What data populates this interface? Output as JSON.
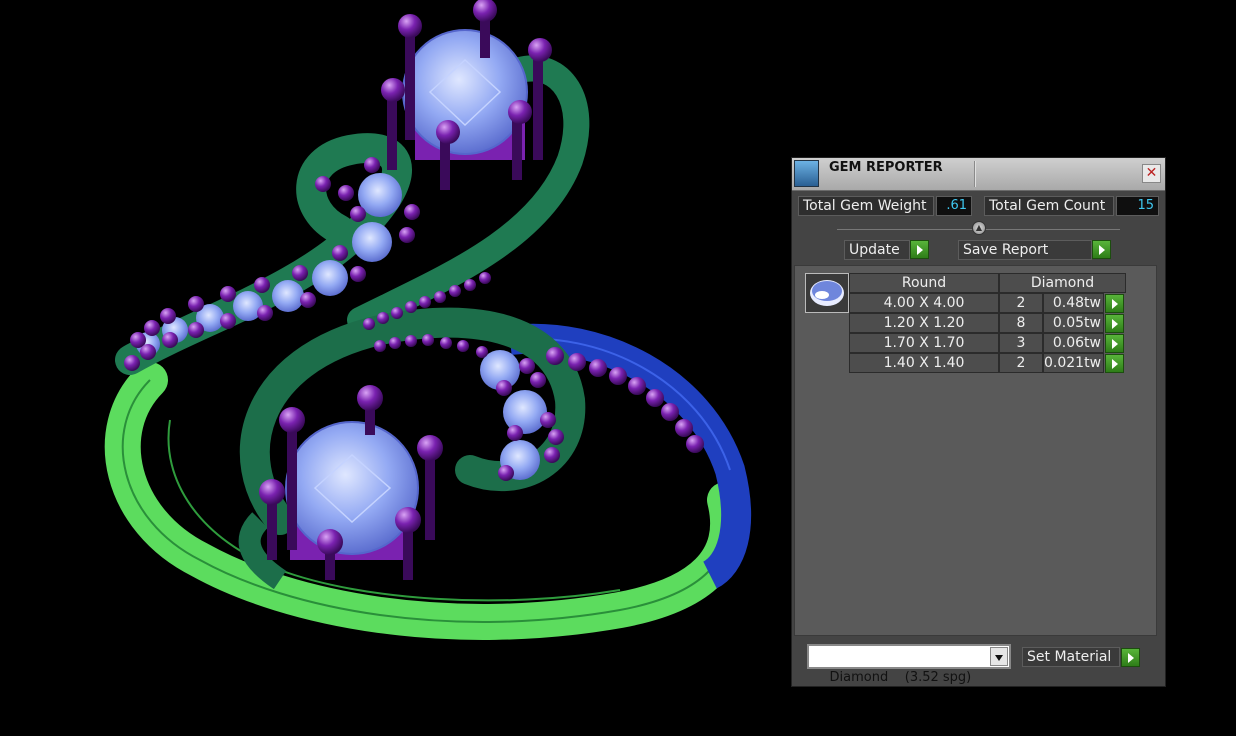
{
  "gem_reporter": {
    "title": "GEM REPORTER",
    "close_icon": "close-icon",
    "total_gem_weight_label": "Total Gem Weight",
    "total_gem_weight_value": ".61",
    "total_gem_count_label": "Total Gem Count",
    "total_gem_count_value": "15",
    "update_label": "Update",
    "save_report_label": "Save Report",
    "table": {
      "shape": "Round",
      "material": "Diamond",
      "rows": [
        {
          "size": "4.00 X 4.00",
          "count": "2",
          "weight": "0.48tw"
        },
        {
          "size": "1.20 X 1.20",
          "count": "8",
          "weight": "0.05tw"
        },
        {
          "size": "1.70 X 1.70",
          "count": "3",
          "weight": "0.06tw"
        },
        {
          "size": "1.40 X 1.40",
          "count": "2",
          "weight": "0.021tw"
        }
      ]
    },
    "material_select_value": "Diamond    (3.52 spg)",
    "set_material_label": "Set Material"
  },
  "colors": {
    "background": "#000000",
    "panel": "#444444",
    "value_text": "#3fc8f0",
    "go_button": "#3f9a26",
    "metal_green": "#58d65a",
    "metal_dark_green": "#1f7a52",
    "metal_blue": "#1f3fbf",
    "gem": "#8fa8f0",
    "prong": "#6a1a9a"
  }
}
